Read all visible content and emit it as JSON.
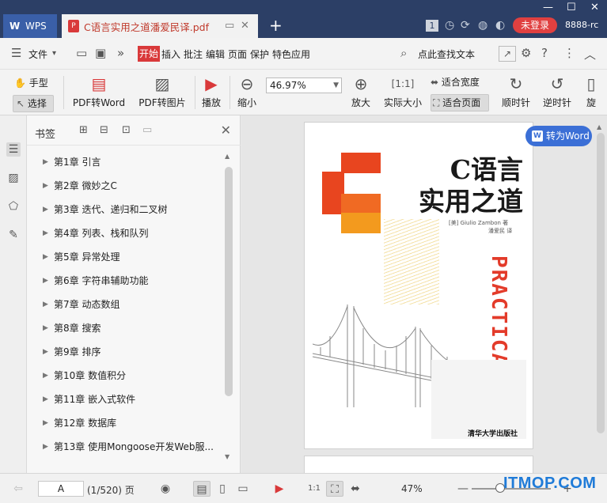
{
  "titlebar": {
    "app_tab": "WPS",
    "doc_tab": "C语言实用之道潘爱民译.pdf",
    "badge": "1",
    "login": "未登录",
    "account": "8888-rc"
  },
  "menubar": {
    "file": "文件",
    "start": "开始",
    "items": [
      "插入",
      "批注",
      "编辑",
      "页面",
      "保护",
      "特色应用"
    ],
    "search": "点此查找文本"
  },
  "ribbon": {
    "hand": "手型",
    "select": "选择",
    "pdf_to_word": "PDF转Word",
    "pdf_to_image": "PDF转图片",
    "play": "播放",
    "zoom_out": "缩小",
    "zoom_value": "46.97%",
    "zoom_in": "放大",
    "actual_size": "实际大小",
    "fit_width": "适合宽度",
    "fit_page": "适合页面",
    "clockwise": "顺时针",
    "counterclockwise": "逆时针",
    "rotate_partial": "旋"
  },
  "panel": {
    "title": "书签",
    "bookmarks": [
      "第1章 引言",
      "第2章 微妙之C",
      "第3章 迭代、递归和二叉树",
      "第4章 列表、栈和队列",
      "第5章 异常处理",
      "第6章 字符串辅助功能",
      "第7章 动态数组",
      "第8章 搜索",
      "第9章 排序",
      "第10章 数值积分",
      "第11章 嵌入式软件",
      "第12章 数据库",
      "第13章 使用Mongoose开发Web服..."
    ]
  },
  "cover": {
    "title_line1": "C语言",
    "title_line2": "实用之道",
    "author": "[美] Giulio Zambon 著",
    "translator": "潘爱民 译",
    "vertical_text": "PRACTICAL C",
    "publisher": "清华大学出版社"
  },
  "to_word": "转为Word",
  "status": {
    "page_input": "A",
    "page_count": "(1/520) 页",
    "zoom": "47%"
  },
  "watermark": "ITMOP.COM"
}
